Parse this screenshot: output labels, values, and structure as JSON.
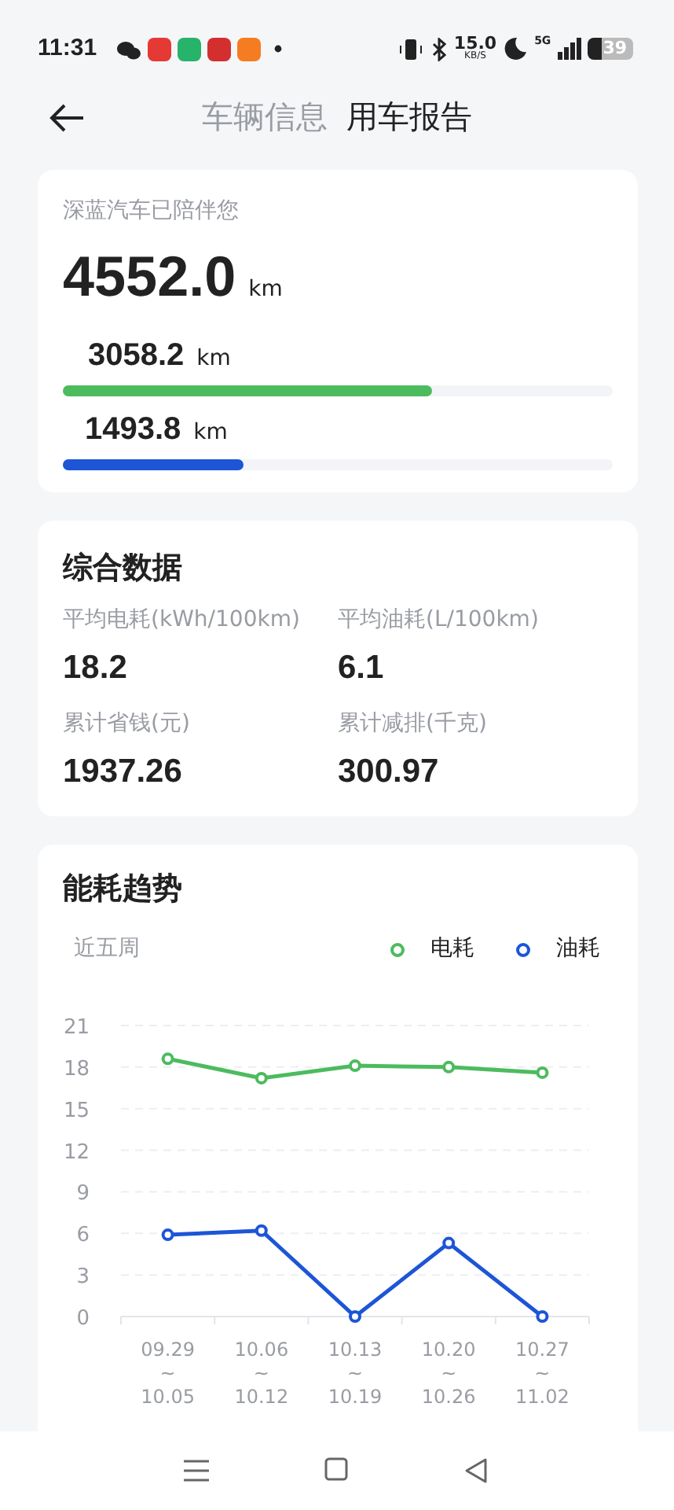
{
  "status_bar": {
    "time": "11:31",
    "speed": "15.0",
    "speed_unit": "KB/S",
    "network": "5G",
    "battery": "39"
  },
  "header": {
    "tabs": [
      {
        "label": "车辆信息",
        "selected": false
      },
      {
        "label": "用车报告",
        "selected": true
      }
    ]
  },
  "mileage": {
    "caption": "深蓝汽车已陪伴您",
    "total": "4552.0",
    "unit": "km",
    "bars": [
      {
        "value": "3058.2",
        "unit": "km",
        "level": 0.672,
        "color": "#4cbb5e"
      },
      {
        "value": "1493.8",
        "unit": "km",
        "level": 0.328,
        "color": "#1d55d6"
      }
    ]
  },
  "summary": {
    "title": "综合数据",
    "stats": [
      {
        "label": "平均电耗(kWh/100km)",
        "value": "18.2"
      },
      {
        "label": "平均油耗(L/100km)",
        "value": "6.1"
      },
      {
        "label": "累计省钱(元)",
        "value": "1937.26"
      },
      {
        "label": "累计减排(千克)",
        "value": "300.97"
      }
    ]
  },
  "trend": {
    "title": "能耗趋势",
    "period": "近五周",
    "chart_data": {
      "type": "line",
      "categories": [
        "09.29 ~ 10.05",
        "10.06 ~ 10.12",
        "10.13 ~ 10.19",
        "10.20 ~ 10.26",
        "10.27 ~ 11.02"
      ],
      "series": [
        {
          "name": "电耗",
          "color": "#4cbb5e",
          "marker": true,
          "values": [
            18.6,
            17.2,
            18.1,
            18.0,
            17.6
          ]
        },
        {
          "name": "油耗",
          "color": "#1d55d6",
          "marker": true,
          "values": [
            5.9,
            6.2,
            0,
            5.3,
            0
          ]
        }
      ],
      "grid": true,
      "ylim": [
        0,
        21
      ],
      "yticks": [
        0,
        3,
        6,
        9,
        12,
        15,
        18,
        21
      ]
    }
  }
}
